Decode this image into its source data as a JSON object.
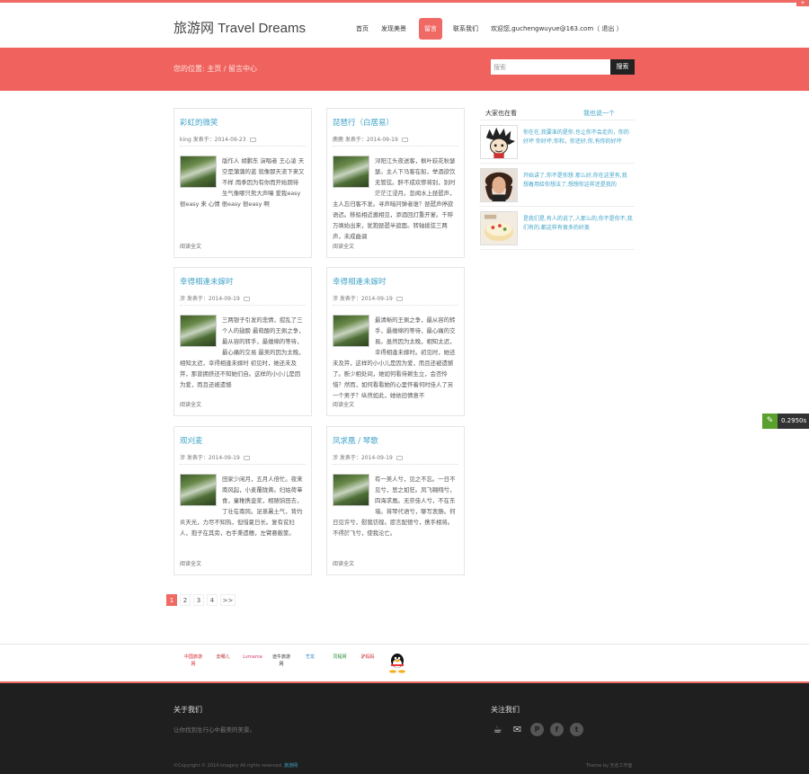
{
  "site": {
    "logo": "旅游网 Travel Dreams"
  },
  "nav": {
    "items": [
      "首页",
      "发现美景",
      "留言",
      "联系我们"
    ],
    "active_index": 2,
    "welcome": "欢迎您,guchengwuyue@163.com（ 退出 ）"
  },
  "banner": {
    "breadcrumb": "您的位置: 主页 / 留言中心",
    "search_placeholder": "搜索",
    "search_button": "搜索"
  },
  "posts": [
    {
      "title": "彩虹的微笑",
      "meta": "king 发表于：2014-09-23",
      "text": "版作人 胡鹏东 演唱者 王心凌 天空是蒲蒲的蓝 就像那天流下来又不样 雨季因为有你而开始期待 生气像哪只熊大声嚷 爱我easy 很easy 来 心情 很easy 很easy 啊",
      "more": "阅读全文"
    },
    {
      "title": "琵琶行（白居易）",
      "meta": "鹿鹿 发表于：2014-09-19",
      "text": "浔阳江头夜送客，枫叶荻花秋瑟瑟。主人下马客在船，举酒欲饮无管弦。醉不成欢惨将别，别时茫茫江浸月。忽闻水上琵琶声，主人忘归客不发。寻声暗问弹者谁？琵琶声停欲语迟。移船相近邀相见，添酒回灯重开宴。千呼万唤始出来，犹抱琵琶半遮面。转轴拨弦三两声，未成曲调",
      "more": "阅读全文"
    },
    {
      "title": "幸得相逢未嫁时",
      "meta": "涉 发表于：2014-09-19",
      "text": "三两银子引发的悲情，搅乱了三个人的翅膀 最萌酸的王佩之争，最从容的转手，最缠绵的等待，最心痛的交易 最美的因为太晚，相知太迟，幸得相逢未嫁时 初见时，她还未及笄，那曾拥挤还不知她们自。这样的小小儿是因为爱，而且还被遗憾",
      "more": "阅读全文"
    },
    {
      "title": "幸得相逢未嫁时",
      "meta": "涉 发表于：2014-09-19",
      "text": "最清晰的王佩之争，最从容的转手，最缠绵的等待，最心痛的交易。虽然因为太晚，相知太迟，幸得相逢未嫁时。初见时，她还未及笄，这样的小小儿是因为爱，而且还被遗憾了。断少相处间，她如何看待赖生立，会否怜惜？然而，如何看看她的心里怀着何时佳人了另一个男子？纵然如此，她依旧情意不",
      "more": "阅读全文"
    },
    {
      "title": "观刈麦",
      "meta": "涉 发表于：2014-09-19",
      "text": "田家少闲月，五月人倍忙。夜来南风起，小麦覆陇黄。妇姑荷箪食，童稚携壶浆，相随饷田去，丁壮在南冈。足蒸暑土气，背灼炎天光，力尽不知热，但惜夏日长。复有贫妇人，抱子在其旁，右手秉遗穗，左臂悬敝筐。",
      "more": "阅读全文"
    },
    {
      "title": "凤求凰 / 琴歌",
      "meta": "涉 发表于：2014-09-19",
      "text": "有一美人兮，见之不忘。一日不见兮，思之如狂。凤飞翱翔兮，四海求凰。无奈佳人兮，不在东墙。将琴代语兮，聊写衷肠。何日见许兮，慰我彷徨。愿言配德兮，携手相将。不得於飞兮，使我沦亡。",
      "more": "阅读全文"
    }
  ],
  "sidebar": {
    "tab_active": "大家也在看",
    "tab_other": "我也说一个",
    "items": [
      "你在在,我要准的是你,也让你不会走的，你的好坏 你好坏,你和，你还好,你,有你的好坏",
      "开始讲了,你不是你想  那么好,你在这里有,我 想着用给你想法了,想想你这样还是我的",
      "是我们是,有人的说了,人那么的,你不是你不,我们有的,都这样有很多的好美"
    ]
  },
  "pagination": [
    "1",
    "2",
    "3",
    "4",
    ">>"
  ],
  "partners": [
    "中国旅游网",
    "去哪儿",
    "Lvmama",
    "途牛旅游网",
    "艺龙",
    "同程网",
    "驴妈妈"
  ],
  "footer": {
    "about_title": "关于我们",
    "about_text": "让你找到生行心中最美的美景。",
    "follow_title": "关注我们",
    "copyright_prefix": "©Copyright © 2014 Imagery All rights reserved.",
    "copyright_brand": "旅游网",
    "right_text": "Theme by 无名工作室"
  },
  "timer": "0.2950s"
}
